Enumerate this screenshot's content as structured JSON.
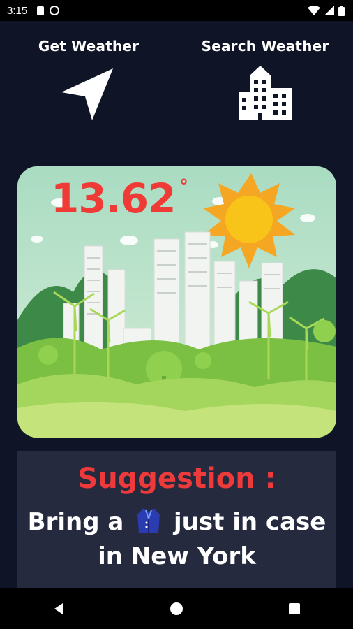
{
  "status_bar": {
    "time": "3:15",
    "icons": [
      "sd-card-icon",
      "sync-icon",
      "wifi-icon",
      "signal-icon",
      "battery-icon"
    ]
  },
  "actions": {
    "get_weather_label": "Get Weather",
    "get_weather_icon": "navigation-arrow-icon",
    "search_weather_label": "Search Weather",
    "search_weather_icon": "city-building-icon"
  },
  "weather": {
    "temperature": "13.62",
    "degree_symbol": "°",
    "illustration": "city-green-landscape-with-sun"
  },
  "suggestion": {
    "title": "Suggestion :",
    "line1_before": "Bring a",
    "line1_item_icon": "coat-icon",
    "line1_after": "just in case",
    "line2": "in New York"
  },
  "colors": {
    "background": "#0f1426",
    "suggestion_bg": "#262a3f",
    "accent_red": "#ee3a3a",
    "sun": "#f8b81a"
  },
  "nav": {
    "icons": [
      "back-icon",
      "home-icon",
      "recents-icon"
    ]
  }
}
